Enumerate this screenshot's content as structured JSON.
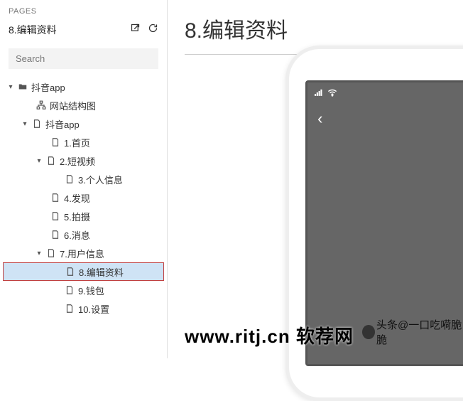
{
  "sidebar": {
    "pages_label": "PAGES",
    "current_page": "8.编辑资料",
    "search_placeholder": "Search"
  },
  "tree": {
    "root_label": "抖音app",
    "sitemap_label": "网站结构图",
    "app_label": "抖音app",
    "p1": "1.首页",
    "p2": "2.短视频",
    "p3": "3.个人信息",
    "p4": "4.发现",
    "p5": "5.拍摄",
    "p6": "6.消息",
    "p7": "7.用户信息",
    "p8": "8.编辑资料",
    "p9": "9.钱包",
    "p10": "10.设置"
  },
  "main": {
    "title": "8.编辑资料"
  },
  "phone": {
    "back_glyph": "‹"
  },
  "watermark": {
    "url": "www.ritj.cn 软荐网",
    "sub": "头条@一口吃嗬脆脆"
  }
}
